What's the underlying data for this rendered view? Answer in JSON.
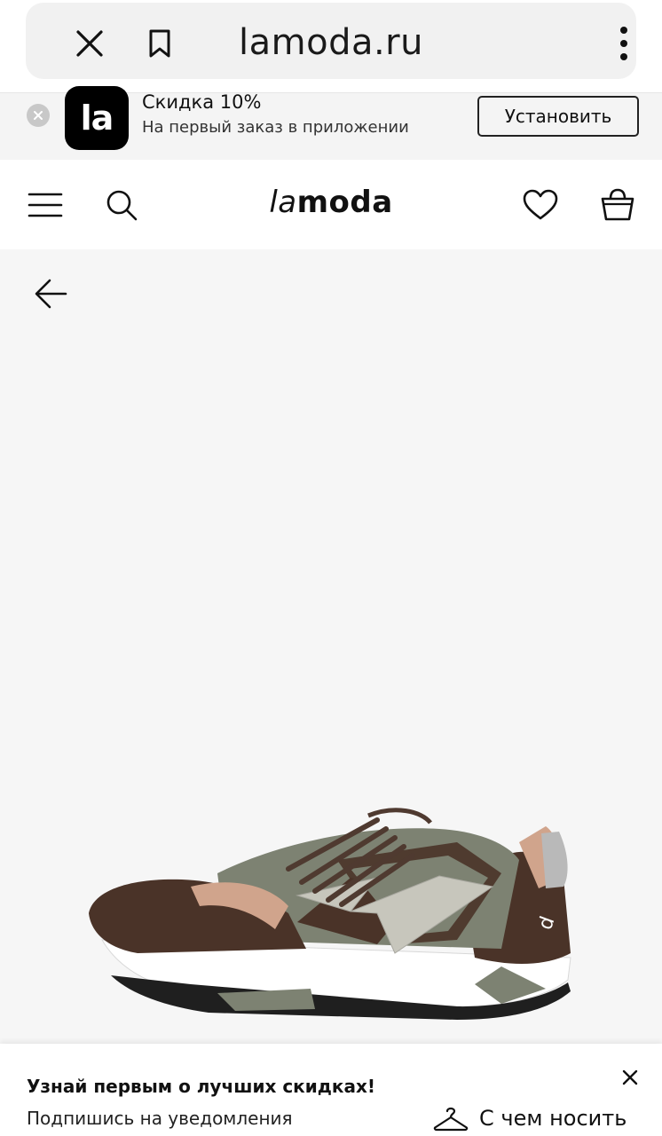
{
  "browser": {
    "url": "lamoda.ru",
    "icons": [
      "close-icon",
      "bookmark-icon",
      "more-vertical-icon"
    ]
  },
  "app_banner": {
    "logo_text": "la",
    "title": "Скидка 10%",
    "subtitle": "На первый заказ в приложении",
    "install_label": "Установить"
  },
  "header": {
    "logo_prefix": "la",
    "logo_rest": "moda",
    "icons": [
      "menu-icon",
      "search-icon",
      "heart-icon",
      "bag-icon"
    ]
  },
  "product": {
    "image": "sneaker",
    "colors": {
      "suede": "#4a3328",
      "mesh": "#7d8272",
      "accent": "#d0a48c",
      "leather": "#c7c6bc",
      "sole": "#ffffff"
    }
  },
  "notification": {
    "title": "Узнай первым о лучших скидках!",
    "subtitle": "Подпишись на уведомления",
    "wear_with_label": "С чем носить"
  }
}
